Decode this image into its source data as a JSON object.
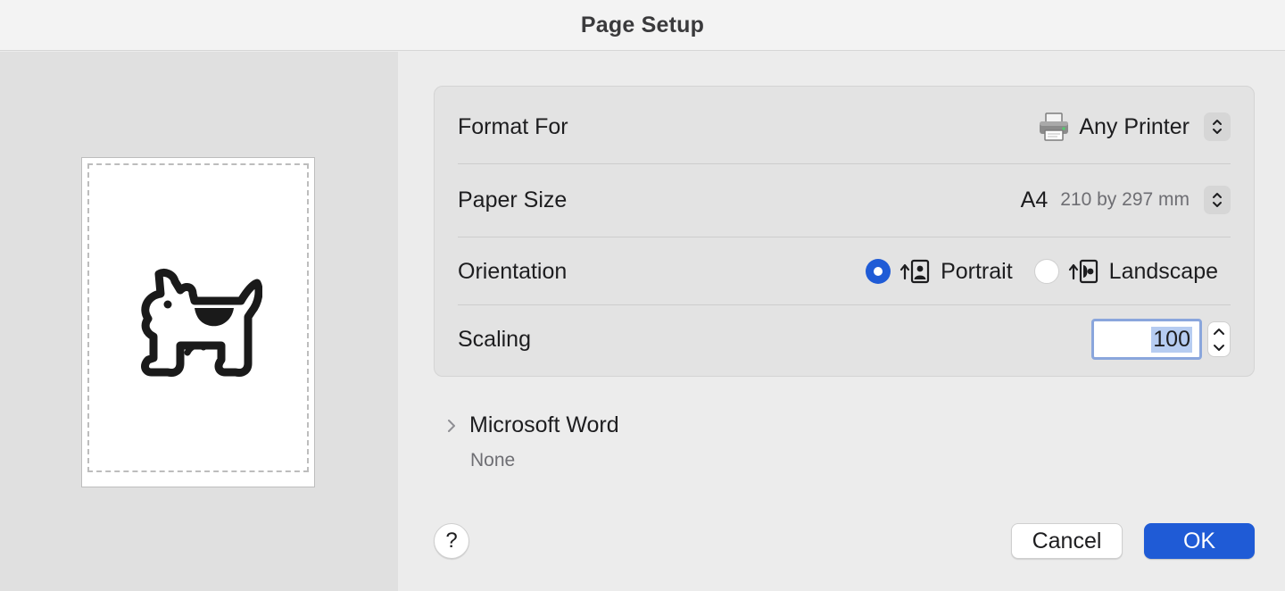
{
  "window": {
    "title": "Page Setup"
  },
  "format_for": {
    "label": "Format For",
    "value": "Any Printer",
    "icon": "printer-icon"
  },
  "paper_size": {
    "label": "Paper Size",
    "value": "A4",
    "dimensions": "210 by 297 mm"
  },
  "orientation": {
    "label": "Orientation",
    "options": [
      {
        "label": "Portrait",
        "selected": true
      },
      {
        "label": "Landscape",
        "selected": false
      }
    ]
  },
  "scaling": {
    "label": "Scaling",
    "value": "100"
  },
  "section": {
    "title": "Microsoft Word",
    "value": "None"
  },
  "buttons": {
    "help": "?",
    "cancel": "Cancel",
    "ok": "OK"
  },
  "colors": {
    "accent": "#1f5bd6",
    "focus_ring": "#8aa6dc",
    "selection": "#b6ccf1"
  }
}
